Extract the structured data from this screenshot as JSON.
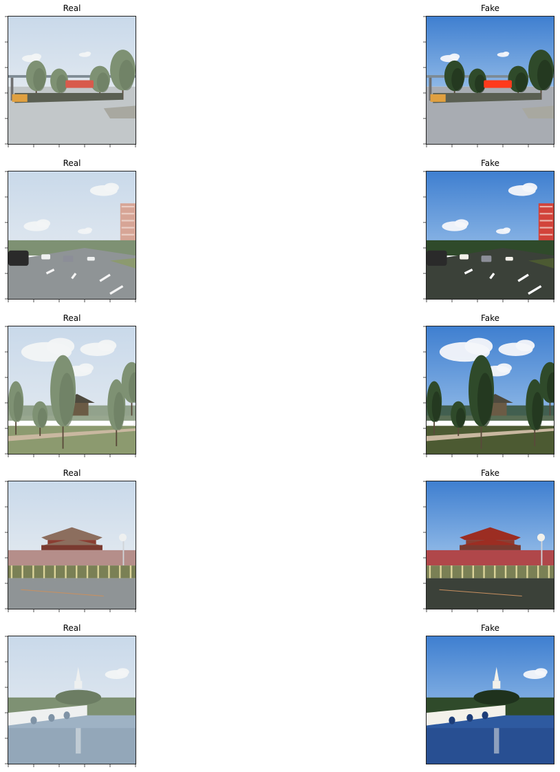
{
  "chart_data": [
    {
      "type": "image",
      "title": "Real",
      "scene": "gate-plaza",
      "variant": "real"
    },
    {
      "type": "image",
      "title": "Fake",
      "scene": "gate-plaza",
      "variant": "fake"
    },
    {
      "type": "image",
      "title": "Real",
      "scene": "highway",
      "variant": "real"
    },
    {
      "type": "image",
      "title": "Fake",
      "scene": "highway",
      "variant": "fake"
    },
    {
      "type": "image",
      "title": "Real",
      "scene": "park-pavilion",
      "variant": "real"
    },
    {
      "type": "image",
      "title": "Fake",
      "scene": "park-pavilion",
      "variant": "fake"
    },
    {
      "type": "image",
      "title": "Real",
      "scene": "tiananmen",
      "variant": "real"
    },
    {
      "type": "image",
      "title": "Fake",
      "scene": "tiananmen",
      "variant": "fake"
    },
    {
      "type": "image",
      "title": "Real",
      "scene": "beihai-bridge",
      "variant": "real"
    },
    {
      "type": "image",
      "title": "Fake",
      "scene": "beihai-bridge",
      "variant": "fake"
    }
  ]
}
